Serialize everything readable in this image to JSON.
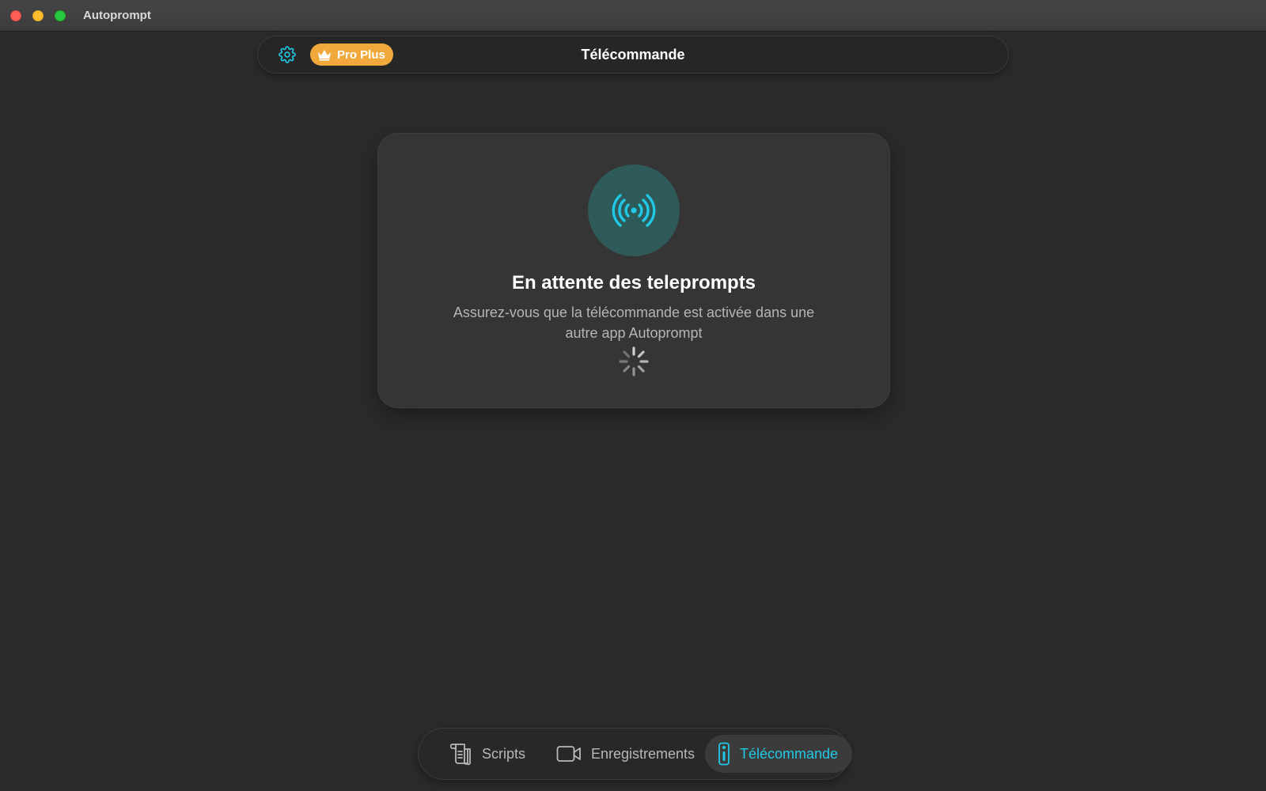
{
  "window": {
    "app_title": "Autoprompt"
  },
  "header": {
    "title": "Télécommande",
    "badge_label": "Pro Plus",
    "settings_icon": "gear-icon",
    "badge_icon": "crown-icon"
  },
  "card": {
    "icon": "broadcast-signal-icon",
    "title": "En attente des teleprompts",
    "description": "Assurez-vous que la télécommande est activée dans une autre app Autoprompt",
    "loading_indicator": "spinner-icon"
  },
  "tabs": [
    {
      "label": "Scripts",
      "icon": "script-scroll-icon",
      "selected": false
    },
    {
      "label": "Enregistrements",
      "icon": "video-camera-icon",
      "selected": false
    },
    {
      "label": "Télécommande",
      "icon": "remote-control-icon",
      "selected": true
    }
  ],
  "colors": {
    "accent": "#21c8e5",
    "badge": "#f2a93b",
    "background": "#2b2b2b",
    "card": "#353535",
    "signal_circle": "#2f5a5a"
  }
}
